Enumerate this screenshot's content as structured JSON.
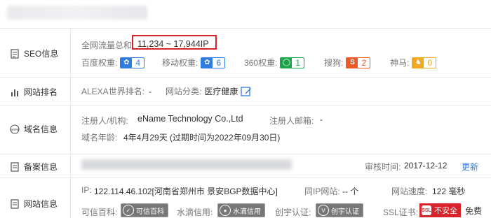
{
  "seo": {
    "section_label": "SEO信息",
    "traffic_label": "全网流量总和:",
    "traffic_value": "11,234 ~ 17,944IP",
    "baidu_label": "百度权重:",
    "baidu_value": "4",
    "mobile_label": "移动权重:",
    "mobile_value": "6",
    "w360_label": "360权重:",
    "w360_value": "1",
    "sogou_label": "搜狗:",
    "sogou_value": "2",
    "shenma_label": "神马:",
    "shenma_value": "0"
  },
  "rank": {
    "section_label": "网站排名",
    "alexa_label": "ALEXA世界排名:",
    "alexa_value": "-",
    "category_label": "网站分类:",
    "category_value": "医疗健康"
  },
  "domain": {
    "section_label": "域名信息",
    "registrant_label": "注册人/机构:",
    "registrant_value": "eName Technology Co.,Ltd",
    "email_label": "注册人邮箱:",
    "email_value": "-",
    "age_label": "域名年龄:",
    "age_value": "4年4月29天 (过期时间为2022年09月30日)"
  },
  "beian": {
    "section_label": "备案信息",
    "review_label": "审核时间:",
    "review_value": "2017-12-12",
    "update_link": "更新"
  },
  "site": {
    "section_label": "网站信息",
    "ip_label": "IP:",
    "ip_value": "122.114.46.102[河南省郑州市 景安BGP数据中心]",
    "same_ip_label": "同IP网站:",
    "same_ip_value": "-- 个",
    "speed_label": "网站速度:",
    "speed_value": "122 毫秒",
    "kexin_label": "可信百科:",
    "kexin_badge": "可信百科",
    "shuidi_label": "水滴信用:",
    "shuidi_badge": "水滴信用",
    "chuangyu_label": "创宇认证:",
    "chuangyu_badge": "创宇认证",
    "ssl_label": "SSL证书:",
    "ssl_badge": "不安全",
    "ssl_free": "免费"
  },
  "colors": {
    "baidu": "#2f7de1",
    "w360": "#1aa54a",
    "sogou": "#f05a28",
    "shenma": "#f3a81d",
    "highlight": "#d9232b",
    "link": "#2f7de1"
  }
}
